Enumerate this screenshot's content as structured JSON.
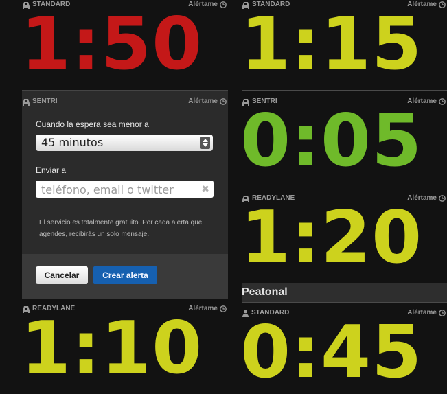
{
  "alert_label": "Alértame",
  "left_lanes": [
    {
      "type": "STANDARD",
      "wait": "1:50",
      "color": "#c41818"
    },
    {
      "type": "READYLANE",
      "wait": "1:10",
      "color": "#cdd21d"
    }
  ],
  "right_lanes": [
    {
      "type": "STANDARD",
      "wait": "1:15",
      "color": "#cdd21d"
    },
    {
      "type": "SENTRI",
      "wait": "0:05",
      "color": "#6fba2a"
    },
    {
      "type": "READYLANE",
      "wait": "1:20",
      "color": "#cdd21d"
    }
  ],
  "pedestrian": {
    "section_title": "Peatonal",
    "lane": {
      "type": "STANDARD",
      "wait": "0:45",
      "color": "#cdd21d"
    }
  },
  "alert_form": {
    "lane_type": "SENTRI",
    "wait_label": "Cuando la espera sea menor a",
    "wait_selected": "45 minutos",
    "send_label": "Enviar a",
    "contact_placeholder": "teléfono, email o twitter",
    "note": "El servicio es totalmente gratuito. Por cada alerta que agendes, recibirás un solo mensaje.",
    "cancel_label": "Cancelar",
    "create_label": "Crear alerta"
  }
}
